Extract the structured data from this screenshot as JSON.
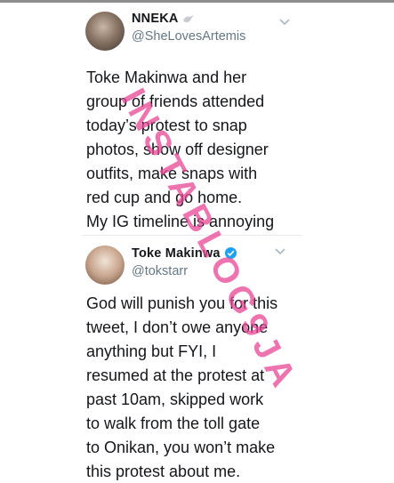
{
  "tweets": [
    {
      "display_name": "NNEKA",
      "handle": "@SheLovesArtemis",
      "avatar_icon": "profile-photo-icon",
      "name_badge_icon": "bird-icon",
      "menu_icon": "chevron-down-icon",
      "body": "Toke Makinwa and her\ngroup of friends attended\ntoday’s protest to snap\nphotos, show off designer\noutfits, make snaps with\nred cup and go home.\nMy IG timeline is annoying"
    },
    {
      "display_name": "Toke Makinwa",
      "handle": "@tokstarr",
      "avatar_icon": "profile-photo-icon",
      "name_badge_icon": "verified-badge-icon",
      "menu_icon": "chevron-down-icon",
      "body": "God will punish you for this\ntweet, I don’t owe anyone\nanything but FYI, I\nresumed at the protest at\npast 10am, skipped work\nto walk from  the toll gate\nto Onikan, you won’t make\nthis protest about me."
    }
  ],
  "watermark": "INSTABLOG9JA",
  "colors": {
    "text": "#14171a",
    "handle": "#657786",
    "verified": "#1da1f2",
    "watermark": "#e84696"
  }
}
